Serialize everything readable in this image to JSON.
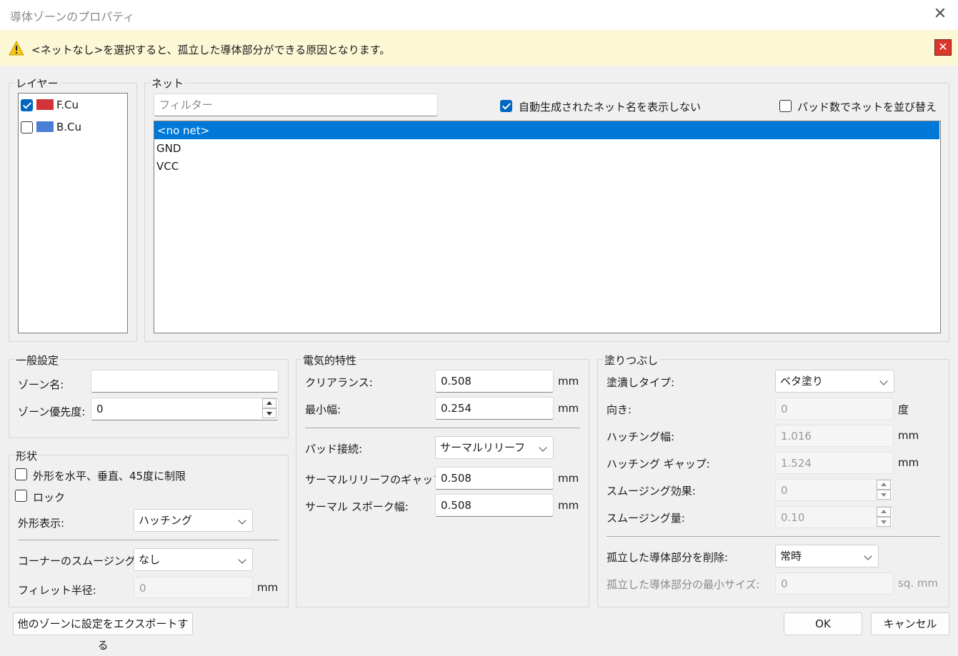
{
  "window": {
    "title": "導体ゾーンのプロパティ",
    "close_glyph": "✕"
  },
  "warning": {
    "text": "<ネットなし>を選択すると、孤立した導体部分ができる原因となります。",
    "close_glyph": "✕"
  },
  "layers": {
    "label": "レイヤー",
    "items": [
      {
        "name": "F.Cu",
        "checked": true,
        "color": "#d13438"
      },
      {
        "name": "B.Cu",
        "checked": false,
        "color": "#4a7fd6"
      }
    ]
  },
  "nets": {
    "label": "ネット",
    "filter_placeholder": "フィルター",
    "hide_auto_label": "自動生成されたネット名を表示しない",
    "hide_auto_checked": true,
    "sort_by_pads_label": "パッド数でネットを並び替え",
    "sort_by_pads_checked": false,
    "items": [
      "<no net>",
      "GND",
      "VCC"
    ],
    "selected": "<no net>"
  },
  "general": {
    "label": "一般設定",
    "zone_name_label": "ゾーン名:",
    "zone_name_value": "",
    "priority_label": "ゾーン優先度:",
    "priority_value": "0"
  },
  "shape": {
    "label": "形状",
    "constrain_label": "外形を水平、垂直、45度に制限",
    "lock_label": "ロック",
    "outline_display_label": "外形表示:",
    "outline_display_value": "ハッチング",
    "corner_smoothing_label": "コーナーのスムージング:",
    "corner_smoothing_value": "なし",
    "fillet_radius_label": "フィレット半径:",
    "fillet_radius_value": "0",
    "fillet_radius_unit": "mm"
  },
  "electrical": {
    "label": "電気的特性",
    "clearance_label": "クリアランス:",
    "clearance_value": "0.508",
    "clearance_unit": "mm",
    "min_width_label": "最小幅:",
    "min_width_value": "0.254",
    "min_width_unit": "mm",
    "pad_connection_label": "パッド接続:",
    "pad_connection_value": "サーマルリリーフ",
    "thermal_gap_label": "サーマルリリーフのギャップ:",
    "thermal_gap_value": "0.508",
    "thermal_gap_unit": "mm",
    "spoke_width_label": "サーマル スポーク幅:",
    "spoke_width_value": "0.508",
    "spoke_width_unit": "mm"
  },
  "fill": {
    "label": "塗りつぶし",
    "fill_type_label": "塗潰しタイプ:",
    "fill_type_value": "ベタ塗り",
    "orientation_label": "向き:",
    "orientation_value": "0",
    "orientation_unit": "度",
    "hatch_width_label": "ハッチング幅:",
    "hatch_width_value": "1.016",
    "hatch_width_unit": "mm",
    "hatch_gap_label": "ハッチング ギャップ:",
    "hatch_gap_value": "1.524",
    "hatch_gap_unit": "mm",
    "smoothing_effort_label": "スムージング効果:",
    "smoothing_effort_value": "0",
    "smoothing_amount_label": "スムージング量:",
    "smoothing_amount_value": "0.10",
    "remove_islands_label": "孤立した導体部分を削除:",
    "remove_islands_value": "常時",
    "min_island_label": "孤立した導体部分の最小サイズ:",
    "min_island_value": "0",
    "min_island_unit": "sq. mm"
  },
  "buttons": {
    "export": "他のゾーンに設定をエクスポートする",
    "ok": "OK",
    "cancel": "キャンセル"
  },
  "colors": {
    "accent": "#0067c0",
    "warning_bg": "#fcf8d6",
    "selection": "#0078d7"
  }
}
